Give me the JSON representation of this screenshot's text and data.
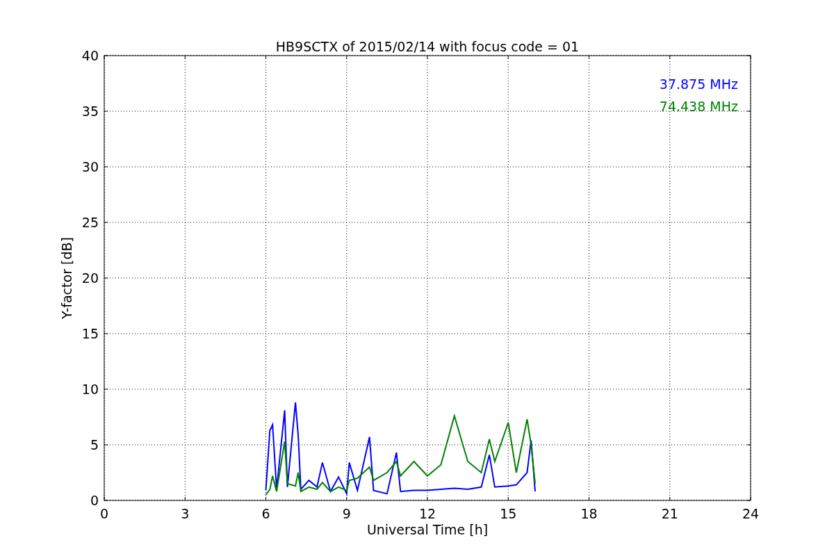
{
  "chart_data": {
    "type": "line",
    "title": "HB9SCTX of 2015/02/14 with focus code = 01",
    "xlabel": "Universal Time [h]",
    "ylabel": "Y-factor [dB]",
    "x": [
      6,
      6.15,
      6.25,
      6.4,
      6.7,
      6.8,
      7.1,
      7.2,
      7.3,
      7.6,
      7.9,
      8.1,
      8.4,
      8.7,
      9.0,
      9.1,
      9.4,
      9.85,
      10.0,
      10.5,
      10.85,
      11.0,
      11.5,
      12.0,
      12.5,
      13.0,
      13.5,
      14.0,
      14.3,
      14.5,
      15.0,
      15.3,
      15.7,
      15.85,
      16
    ],
    "series": [
      {
        "name": "37.875 MHz",
        "color": "#0000ff",
        "values": [
          0.9,
          6.3,
          6.8,
          1.0,
          8.1,
          1.2,
          8.8,
          5.9,
          1.0,
          1.8,
          1.2,
          3.4,
          0.8,
          2.1,
          0.6,
          3.4,
          0.9,
          5.7,
          0.9,
          0.6,
          4.3,
          0.8,
          0.9,
          0.9,
          1.0,
          1.1,
          1.0,
          1.2,
          4.1,
          1.2,
          1.3,
          1.4,
          2.5,
          5.4,
          0.8
        ]
      },
      {
        "name": "74.438 MHz",
        "color": "#008000",
        "values": [
          0.5,
          1.0,
          2.2,
          0.8,
          5.3,
          1.5,
          1.3,
          2.5,
          0.8,
          1.2,
          1.0,
          1.6,
          0.8,
          1.2,
          0.9,
          1.8,
          2.0,
          3.0,
          1.8,
          2.5,
          3.5,
          2.2,
          3.5,
          2.2,
          3.2,
          7.6,
          3.5,
          2.5,
          5.5,
          3.5,
          7.0,
          2.5,
          7.3,
          5.0,
          1.5
        ]
      }
    ],
    "grid": true,
    "xlim": [
      0,
      24
    ],
    "ylim": [
      0,
      40
    ],
    "xticks": [
      0,
      3,
      6,
      9,
      12,
      15,
      18,
      21,
      24
    ],
    "yticks": [
      0,
      5,
      10,
      15,
      20,
      25,
      30,
      35,
      40
    ]
  }
}
